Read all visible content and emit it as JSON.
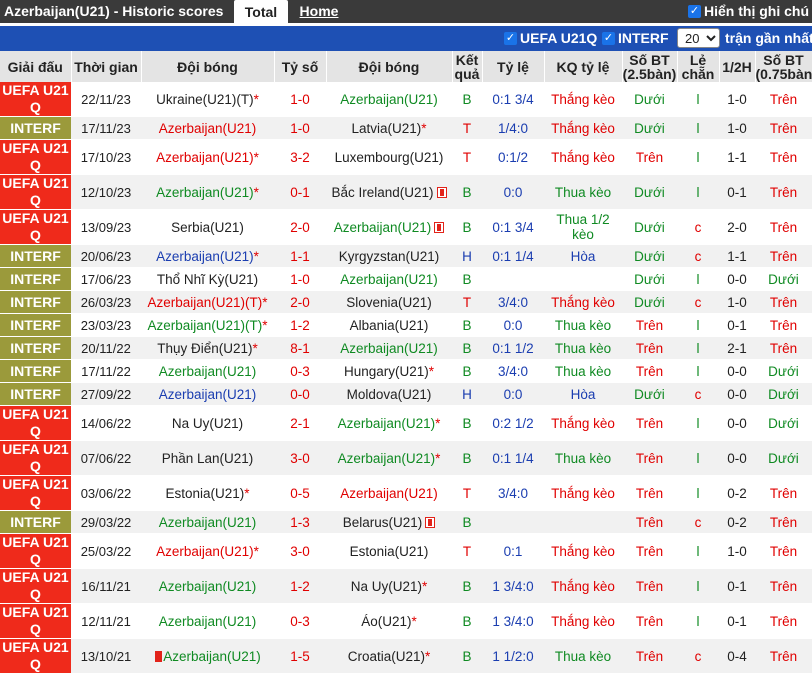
{
  "header": {
    "title": "Azerbaijan(U21) - Historic scores",
    "tab_total": "Total",
    "tab_home": "Home",
    "show_notes": "Hiển thị ghi chú"
  },
  "filters": {
    "uefa": "UEFA U21Q",
    "interf": "INTERF",
    "count": "20",
    "recent": "trận gần nhất"
  },
  "columns": {
    "league": "Giải đấu",
    "time": "Thời gian",
    "team1": "Đội bóng",
    "score": "Tỷ số",
    "team2": "Đội bóng",
    "result": "Kết quả",
    "odds": "Tỷ lệ",
    "odds_result": "KQ tỷ lệ",
    "goals": "Số BT (2.5bàn)",
    "oddeven": "Lẻ chẵn",
    "half": "1/2H",
    "goals2": "Số BT (0.75bàn)"
  },
  "colors": {
    "u21": "#ef2a1b",
    "interf": "#9b9a3b",
    "win": "#0f8a22",
    "lose": "#e00000",
    "draw": "#1a3db0"
  },
  "rows": [
    {
      "league": "UEFA U21 Q",
      "date": "22/11/23",
      "team1": "Ukraine(U21)(T)",
      "score": "1-0",
      "team2": "Azerbaijan(U21)",
      "result": "B",
      "odds": "0:1 3/4",
      "odds_result": "Thắng kèo",
      "goals": "Dưới",
      "oe": "l",
      "half": "1-0",
      "goals2": "Trên"
    },
    {
      "league": "INTERF",
      "date": "17/11/23",
      "team1": "Azerbaijan(U21)",
      "score": "1-0",
      "team2": "Latvia(U21)",
      "result": "T",
      "odds": "1/4:0",
      "odds_result": "Thắng kèo",
      "goals": "Dưới",
      "oe": "l",
      "half": "1-0",
      "goals2": "Trên"
    },
    {
      "league": "UEFA U21 Q",
      "date": "17/10/23",
      "team1": "Azerbaijan(U21)",
      "score": "3-2",
      "team2": "Luxembourg(U21)",
      "result": "T",
      "odds": "0:1/2",
      "odds_result": "Thắng kèo",
      "goals": "Trên",
      "oe": "l",
      "half": "1-1",
      "goals2": "Trên"
    },
    {
      "league": "UEFA U21 Q",
      "date": "12/10/23",
      "team1": "Azerbaijan(U21)",
      "score": "0-1",
      "team2": "Bắc Ireland(U21)",
      "result": "B",
      "odds": "0:0",
      "odds_result": "Thua kèo",
      "goals": "Dưới",
      "oe": "l",
      "half": "0-1",
      "goals2": "Trên"
    },
    {
      "league": "UEFA U21 Q",
      "date": "13/09/23",
      "team1": "Serbia(U21)",
      "score": "2-0",
      "team2": "Azerbaijan(U21)",
      "result": "B",
      "odds": "0:1 3/4",
      "odds_result": "Thua 1/2 kèo",
      "goals": "Dưới",
      "oe": "c",
      "half": "2-0",
      "goals2": "Trên"
    },
    {
      "league": "INTERF",
      "date": "20/06/23",
      "team1": "Azerbaijan(U21)",
      "score": "1-1",
      "team2": "Kyrgyzstan(U21)",
      "result": "H",
      "odds": "0:1 1/4",
      "odds_result": "Hòa",
      "goals": "Dưới",
      "oe": "c",
      "half": "1-1",
      "goals2": "Trên"
    },
    {
      "league": "INTERF",
      "date": "17/06/23",
      "team1": "Thổ Nhĩ Kỳ(U21)",
      "score": "1-0",
      "team2": "Azerbaijan(U21)",
      "result": "B",
      "odds": "",
      "odds_result": "",
      "goals": "Dưới",
      "oe": "l",
      "half": "0-0",
      "goals2": "Dưới"
    },
    {
      "league": "INTERF",
      "date": "26/03/23",
      "team1": "Azerbaijan(U21)(T)",
      "score": "2-0",
      "team2": "Slovenia(U21)",
      "result": "T",
      "odds": "3/4:0",
      "odds_result": "Thắng kèo",
      "goals": "Dưới",
      "oe": "c",
      "half": "1-0",
      "goals2": "Trên"
    },
    {
      "league": "INTERF",
      "date": "23/03/23",
      "team1": "Azerbaijan(U21)(T)",
      "score": "1-2",
      "team2": "Albania(U21)",
      "result": "B",
      "odds": "0:0",
      "odds_result": "Thua kèo",
      "goals": "Trên",
      "oe": "l",
      "half": "0-1",
      "goals2": "Trên"
    },
    {
      "league": "INTERF",
      "date": "20/11/22",
      "team1": "Thụy Điển(U21)",
      "score": "8-1",
      "team2": "Azerbaijan(U21)",
      "result": "B",
      "odds": "0:1 1/2",
      "odds_result": "Thua kèo",
      "goals": "Trên",
      "oe": "l",
      "half": "2-1",
      "goals2": "Trên"
    },
    {
      "league": "INTERF",
      "date": "17/11/22",
      "team1": "Azerbaijan(U21)",
      "score": "0-3",
      "team2": "Hungary(U21)",
      "result": "B",
      "odds": "3/4:0",
      "odds_result": "Thua kèo",
      "goals": "Trên",
      "oe": "l",
      "half": "0-0",
      "goals2": "Dưới"
    },
    {
      "league": "INTERF",
      "date": "27/09/22",
      "team1": "Azerbaijan(U21)",
      "score": "0-0",
      "team2": "Moldova(U21)",
      "result": "H",
      "odds": "0:0",
      "odds_result": "Hòa",
      "goals": "Dưới",
      "oe": "c",
      "half": "0-0",
      "goals2": "Dưới"
    },
    {
      "league": "UEFA U21 Q",
      "date": "14/06/22",
      "team1": "Na Uy(U21)",
      "score": "2-1",
      "team2": "Azerbaijan(U21)",
      "result": "B",
      "odds": "0:2 1/2",
      "odds_result": "Thắng kèo",
      "goals": "Trên",
      "oe": "l",
      "half": "0-0",
      "goals2": "Dưới"
    },
    {
      "league": "UEFA U21 Q",
      "date": "07/06/22",
      "team1": "Phần Lan(U21)",
      "score": "3-0",
      "team2": "Azerbaijan(U21)",
      "result": "B",
      "odds": "0:1 1/4",
      "odds_result": "Thua kèo",
      "goals": "Trên",
      "oe": "l",
      "half": "0-0",
      "goals2": "Dưới"
    },
    {
      "league": "UEFA U21 Q",
      "date": "03/06/22",
      "team1": "Estonia(U21)",
      "score": "0-5",
      "team2": "Azerbaijan(U21)",
      "result": "T",
      "odds": "3/4:0",
      "odds_result": "Thắng kèo",
      "goals": "Trên",
      "oe": "l",
      "half": "0-2",
      "goals2": "Trên"
    },
    {
      "league": "INTERF",
      "date": "29/03/22",
      "team1": "Azerbaijan(U21)",
      "score": "1-3",
      "team2": "Belarus(U21)",
      "result": "B",
      "odds": "",
      "odds_result": "",
      "goals": "Trên",
      "oe": "c",
      "half": "0-2",
      "goals2": "Trên"
    },
    {
      "league": "UEFA U21 Q",
      "date": "25/03/22",
      "team1": "Azerbaijan(U21)",
      "score": "3-0",
      "team2": "Estonia(U21)",
      "result": "T",
      "odds": "0:1",
      "odds_result": "Thắng kèo",
      "goals": "Trên",
      "oe": "l",
      "half": "1-0",
      "goals2": "Trên"
    },
    {
      "league": "UEFA U21 Q",
      "date": "16/11/21",
      "team1": "Azerbaijan(U21)",
      "score": "1-2",
      "team2": "Na Uy(U21)",
      "result": "B",
      "odds": "1 3/4:0",
      "odds_result": "Thắng kèo",
      "goals": "Trên",
      "oe": "l",
      "half": "0-1",
      "goals2": "Trên"
    },
    {
      "league": "UEFA U21 Q",
      "date": "12/11/21",
      "team1": "Azerbaijan(U21)",
      "score": "0-3",
      "team2": "Áo(U21)",
      "result": "B",
      "odds": "1 3/4:0",
      "odds_result": "Thắng kèo",
      "goals": "Trên",
      "oe": "l",
      "half": "0-1",
      "goals2": "Trên"
    },
    {
      "league": "UEFA U21 Q",
      "date": "13/10/21",
      "team1": "Azerbaijan(U21)",
      "score": "1-5",
      "team2": "Croatia(U21)",
      "result": "B",
      "odds": "1 1/2:0",
      "odds_result": "Thua kèo",
      "goals": "Trên",
      "oe": "c",
      "half": "0-4",
      "goals2": "Trên"
    }
  ]
}
